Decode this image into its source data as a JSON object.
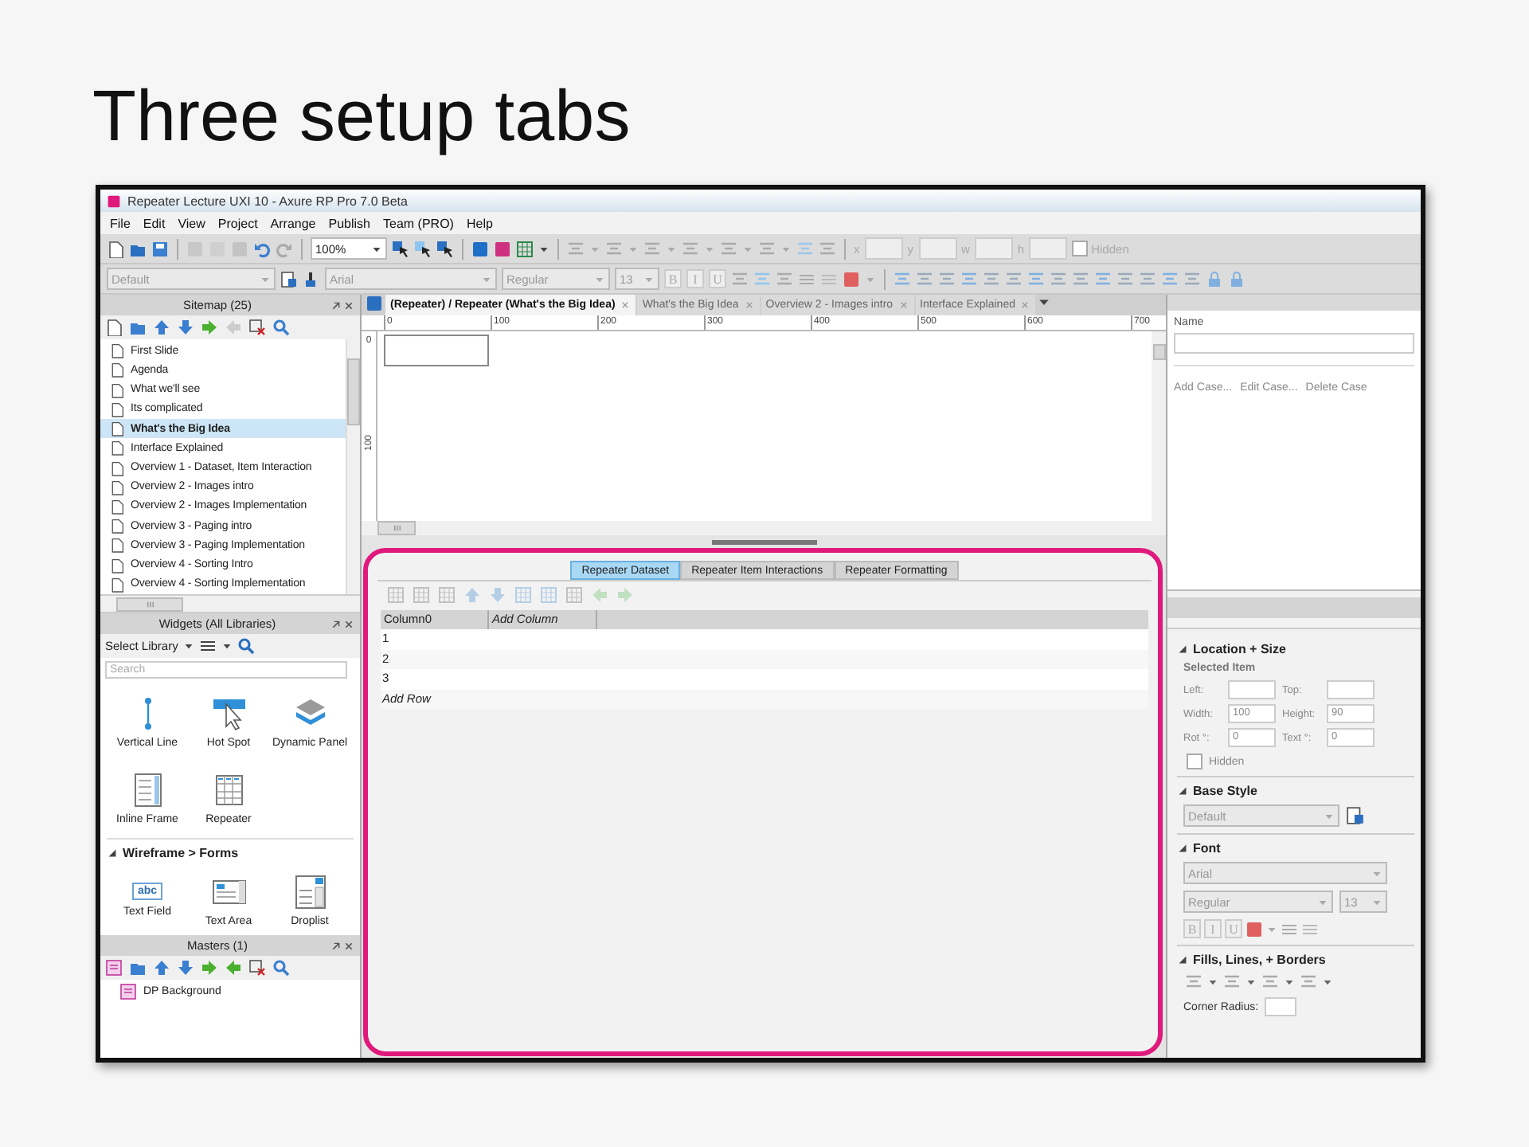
{
  "slide": {
    "title": "Three setup tabs"
  },
  "window": {
    "title": "Repeater Lecture UXI 10 - Axure RP Pro 7.0 Beta"
  },
  "menu": [
    "File",
    "Edit",
    "View",
    "Project",
    "Arrange",
    "Publish",
    "Team (PRO)",
    "Help"
  ],
  "toolbar": {
    "zoom": "100%",
    "style": "Default",
    "font": "Arial",
    "weight": "Regular",
    "size": "13",
    "format_buttons": [
      "B",
      "I",
      "U"
    ],
    "coord_labels": [
      "x",
      "y",
      "w",
      "h"
    ],
    "hidden": {
      "label": "Hidden",
      "checked": false
    }
  },
  "sitemap": {
    "title": "Sitemap (25)",
    "pages": [
      {
        "label": "First Slide",
        "selected": false
      },
      {
        "label": "Agenda",
        "selected": false
      },
      {
        "label": "What we'll see",
        "selected": false
      },
      {
        "label": "Its complicated",
        "selected": false
      },
      {
        "label": "What's the Big Idea",
        "selected": true
      },
      {
        "label": "Interface Explained",
        "selected": false
      },
      {
        "label": "Overview 1 - Dataset, Item Interaction",
        "selected": false
      },
      {
        "label": "Overview 2 - Images intro",
        "selected": false
      },
      {
        "label": "Overview 2 - Images Implementation",
        "selected": false
      },
      {
        "label": "Overview 3 - Paging intro",
        "selected": false
      },
      {
        "label": "Overview 3 - Paging Implementation",
        "selected": false
      },
      {
        "label": "Overview 4 - Sorting Intro",
        "selected": false
      },
      {
        "label": "Overview 4 - Sorting Implementation",
        "selected": false
      }
    ]
  },
  "widgets": {
    "title": "Widgets (All Libraries)",
    "library": "Select Library",
    "search_placeholder": "Search",
    "items": [
      {
        "label": "Vertical Line",
        "kind": "line"
      },
      {
        "label": "Hot Spot",
        "kind": "hotspot"
      },
      {
        "label": "Dynamic Panel",
        "kind": "panel"
      },
      {
        "label": "Inline Frame",
        "kind": "iframe"
      },
      {
        "label": "Repeater",
        "kind": "repeater"
      }
    ],
    "section": "Wireframe > Forms",
    "form_items": [
      {
        "label": "Text Field",
        "kind": "textfield",
        "icon_text": "abc"
      },
      {
        "label": "Text Area",
        "kind": "textarea"
      },
      {
        "label": "Droplist",
        "kind": "droplist"
      }
    ]
  },
  "masters": {
    "title": "Masters (1)",
    "items": [
      "DP Background"
    ]
  },
  "doc_tabs": [
    {
      "label": "(Repeater) / Repeater (What's the Big Idea)",
      "selected": true
    },
    {
      "label": "What's the Big Idea",
      "selected": false
    },
    {
      "label": "Overview 2 - Images intro",
      "selected": false
    },
    {
      "label": "Interface Explained",
      "selected": false
    }
  ],
  "ruler": {
    "x_marks": [
      "0",
      "100",
      "200",
      "300",
      "400",
      "500",
      "600",
      "700"
    ],
    "y_marks": [
      "0",
      "100"
    ]
  },
  "repeater_tabs": [
    {
      "label": "Repeater Dataset",
      "selected": true
    },
    {
      "label": "Repeater Item Interactions",
      "selected": false
    },
    {
      "label": "Repeater Formatting",
      "selected": false
    }
  ],
  "dataset": {
    "columns": [
      "Column0",
      "Add Column"
    ],
    "rows": [
      "1",
      "2",
      "3"
    ],
    "add_row": "Add Row"
  },
  "interactions": {
    "name_label": "Name",
    "actions": [
      "Add Case...",
      "Edit Case...",
      "Delete Case"
    ]
  },
  "properties": {
    "location": {
      "title": "Location + Size",
      "subtitle": "Selected Item",
      "fields": [
        {
          "label": "Left:"
        },
        {
          "label": "Top:"
        },
        {
          "label": "Width:",
          "value": "100"
        },
        {
          "label": "Height:",
          "value": "90"
        },
        {
          "label": "Rot °:",
          "value": "0"
        },
        {
          "label": "Text °:",
          "value": "0"
        }
      ],
      "hidden": {
        "label": "Hidden",
        "checked": false
      }
    },
    "base_style": {
      "title": "Base Style",
      "value": "Default"
    },
    "font": {
      "title": "Font",
      "family": "Arial",
      "weight": "Regular",
      "size": "13",
      "format_buttons": [
        "B",
        "I",
        "U"
      ]
    },
    "fills": {
      "title": "Fills, Lines, + Borders",
      "corner_label": "Corner Radius:"
    }
  }
}
